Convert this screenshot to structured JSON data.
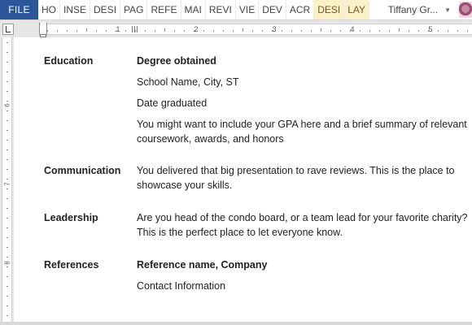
{
  "ribbon": {
    "file_label": "FILE",
    "tabs": [
      {
        "label": "HO",
        "contextual": false
      },
      {
        "label": "INSE",
        "contextual": false
      },
      {
        "label": "DESI",
        "contextual": false
      },
      {
        "label": "PAG",
        "contextual": false
      },
      {
        "label": "REFE",
        "contextual": false
      },
      {
        "label": "MAI",
        "contextual": false
      },
      {
        "label": "REVI",
        "contextual": false
      },
      {
        "label": "VIE",
        "contextual": false
      },
      {
        "label": "DEV",
        "contextual": false
      },
      {
        "label": "ACR",
        "contextual": false
      },
      {
        "label": "DESI",
        "contextual": true
      },
      {
        "label": "LAY",
        "contextual": true
      }
    ],
    "user_name": "Tiffany Gr...",
    "accent_color": "#2b579a",
    "contextual_color": "#fcf0c9"
  },
  "ruler": {
    "numbers": [
      "1",
      "2",
      "3",
      "4",
      "5"
    ],
    "vertical_numbers": [
      "6",
      "7",
      "8"
    ]
  },
  "document": {
    "sections": [
      {
        "heading": "Education",
        "lines": [
          {
            "text": "Degree obtained",
            "bold": true
          },
          {
            "text": "School Name, City, ST",
            "bold": false
          },
          {
            "text": "Date graduated",
            "bold": false
          },
          {
            "text": "You might want to include your GPA here and a brief summary of relevant",
            "bold": false
          },
          {
            "text": "coursework, awards, and honors",
            "bold": false
          }
        ]
      },
      {
        "heading": "Communication",
        "lines": [
          {
            "text": "You delivered that big presentation to rave reviews. This is the place to",
            "bold": false
          },
          {
            "text": "showcase your skills.",
            "bold": false
          }
        ]
      },
      {
        "heading": "Leadership",
        "lines": [
          {
            "text": "Are you head of the condo board, or a team lead for your favorite charity?",
            "bold": false
          },
          {
            "text": "This is the perfect place to let everyone know.",
            "bold": false
          }
        ]
      },
      {
        "heading": "References",
        "lines": [
          {
            "text": "Reference name, Company",
            "bold": true
          },
          {
            "text": "Contact Information",
            "bold": false
          }
        ]
      }
    ]
  }
}
